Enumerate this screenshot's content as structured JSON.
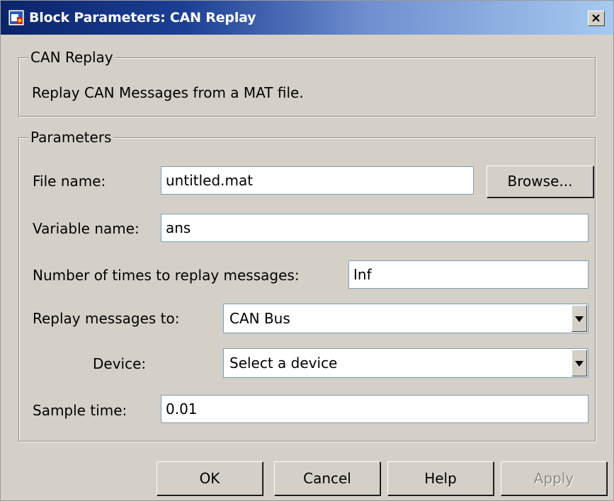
{
  "window": {
    "title": "Block Parameters: CAN Replay"
  },
  "description_group": {
    "legend": "CAN Replay",
    "text": "Replay CAN Messages from a MAT file."
  },
  "parameters_group": {
    "legend": "Parameters",
    "file_name": {
      "label": "File name:",
      "value": "untitled.mat",
      "browse_label": "Browse..."
    },
    "variable_name": {
      "label": "Variable name:",
      "value": "ans"
    },
    "replay_times": {
      "label": "Number of times to replay messages:",
      "value": "Inf"
    },
    "replay_to": {
      "label": "Replay messages to:",
      "value": "CAN Bus"
    },
    "device": {
      "label": "Device:",
      "value": "Select a device"
    },
    "sample_time": {
      "label": "Sample time:",
      "value": "0.01"
    }
  },
  "buttons": {
    "ok": "OK",
    "cancel": "Cancel",
    "help": "Help",
    "apply": "Apply"
  },
  "colors": {
    "titlebar_start": "#0a246a",
    "titlebar_end": "#a6caf0",
    "dialog_bg": "#d4d0c8",
    "field_border": "#7f9db9"
  },
  "icons": {
    "window_icon": "simulink-block-icon",
    "close_icon": "close-x-icon",
    "dropdown_icon": "triangle-down-icon"
  }
}
